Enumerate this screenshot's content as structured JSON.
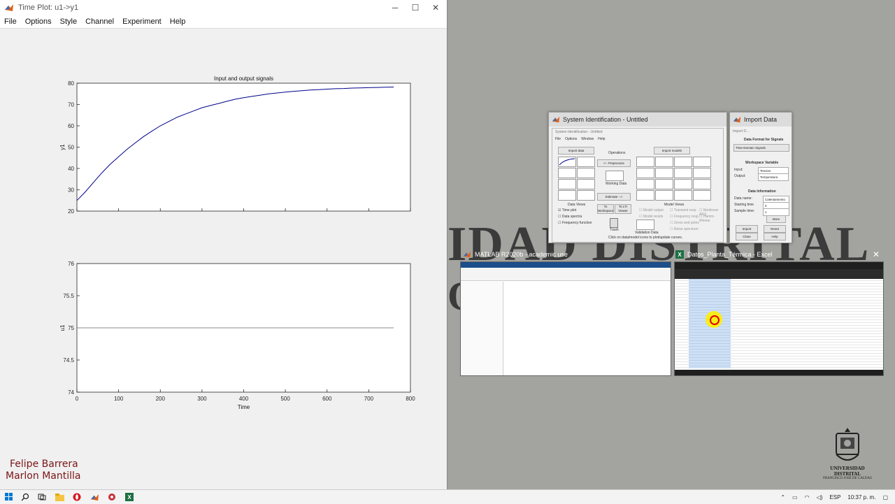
{
  "timeplot": {
    "title": "Time Plot: u1->y1",
    "menus": [
      "File",
      "Options",
      "Style",
      "Channel",
      "Experiment",
      "Help"
    ]
  },
  "chart_data": [
    {
      "type": "line",
      "title": "Input and output signals",
      "xlabel": "",
      "ylabel": "y1",
      "xlim": [
        0,
        800
      ],
      "ylim": [
        20,
        80
      ],
      "yticks": [
        20,
        30,
        40,
        50,
        60,
        70,
        80
      ],
      "series": [
        {
          "color": "#00008b",
          "x": [
            0,
            20,
            40,
            60,
            80,
            100,
            120,
            140,
            160,
            180,
            200,
            220,
            240,
            260,
            280,
            300,
            320,
            340,
            360,
            380,
            400,
            420,
            440,
            460,
            480,
            500,
            520,
            540,
            560,
            580,
            600,
            620,
            640,
            660,
            680,
            700,
            720,
            740,
            760
          ],
          "y": [
            25,
            29,
            33.5,
            38,
            42,
            45.5,
            49,
            52,
            55,
            57.5,
            60,
            62,
            64,
            65.5,
            67,
            68.5,
            69.5,
            70.5,
            71.5,
            72.5,
            73.2,
            73.8,
            74.4,
            75,
            75.4,
            75.8,
            76.2,
            76.5,
            76.8,
            77,
            77.2,
            77.4,
            77.5,
            77.7,
            77.8,
            77.9,
            78,
            78.1,
            78.2
          ]
        }
      ]
    },
    {
      "type": "line",
      "title": "",
      "xlabel": "Time",
      "ylabel": "u1",
      "xlim": [
        0,
        800
      ],
      "ylim": [
        74,
        76
      ],
      "xticks": [
        0,
        100,
        200,
        300,
        400,
        500,
        600,
        700,
        800
      ],
      "yticks": [
        74,
        74.5,
        75,
        75.5,
        76
      ],
      "series": [
        {
          "color": "#888888",
          "x": [
            0,
            760
          ],
          "y": [
            75,
            75
          ]
        }
      ]
    }
  ],
  "credits": [
    "Felipe Barrera",
    "Marlon Mantilla"
  ],
  "sysident": {
    "title": "System Identification - Untitled",
    "inner_title": "System Identification - Untitled",
    "menus": [
      "File",
      "Options",
      "Window",
      "Help"
    ],
    "import_data": "Import data",
    "import_models": "Import models",
    "operations": "Operations",
    "preprocess": "<-- Preprocess",
    "working_data": "Working Data",
    "estimate": "Estimate -->",
    "data_views": "Data Views",
    "model_views": "Model Views",
    "to_workspace": "To Workspace",
    "to_lti": "To LTI Viewer",
    "trash": "Trash",
    "validation_data": "Validation Data",
    "dataset_label": "Calentamiento",
    "checks": [
      "Time plot",
      "Data spectra",
      "Frequency function"
    ],
    "model_checks": [
      "Model output",
      "Model resids",
      "Transient resp",
      "Frequency resp",
      "Zeros and poles",
      "Noise spectrum",
      "Nonlinear ARX",
      "Hamm-Wiener"
    ],
    "hint": "Click on data/model icons to plot/update curves."
  },
  "importdata": {
    "title": "Import Data",
    "inner_title": "Import D...",
    "data_format_label": "Data Format for Signals",
    "data_format_value": "Time-Domain Signals",
    "workspace_variable": "Workspace Variable",
    "input_label": "Input:",
    "input_value": "Tension",
    "output_label": "Output:",
    "output_value": "Temperatura",
    "data_information": "Data Information",
    "data_name_label": "Data name:",
    "data_name_value": "Calentamiento",
    "starting_time_label": "Starting time",
    "starting_time_value": "0",
    "sample_time_label": "Sample time:",
    "sample_time_value": "1",
    "more": "More",
    "import": "Import",
    "reset": "Reset",
    "close": "Close",
    "help": "Help"
  },
  "matlab_thumb": {
    "title": "MATLAB R2020b - academic use"
  },
  "excel_thumb": {
    "title": "Datos_Planta_Térmica - Excel"
  },
  "watermark": {
    "line1": "IDAD DISTRITAL",
    "line2": "O"
  },
  "logo": {
    "name": "UNIVERSIDAD DISTRITAL",
    "sub": "FRANCISCO JOSÉ DE CALDAS"
  },
  "taskbar": {
    "lang": "ESP",
    "time": "10:37 p. m."
  }
}
